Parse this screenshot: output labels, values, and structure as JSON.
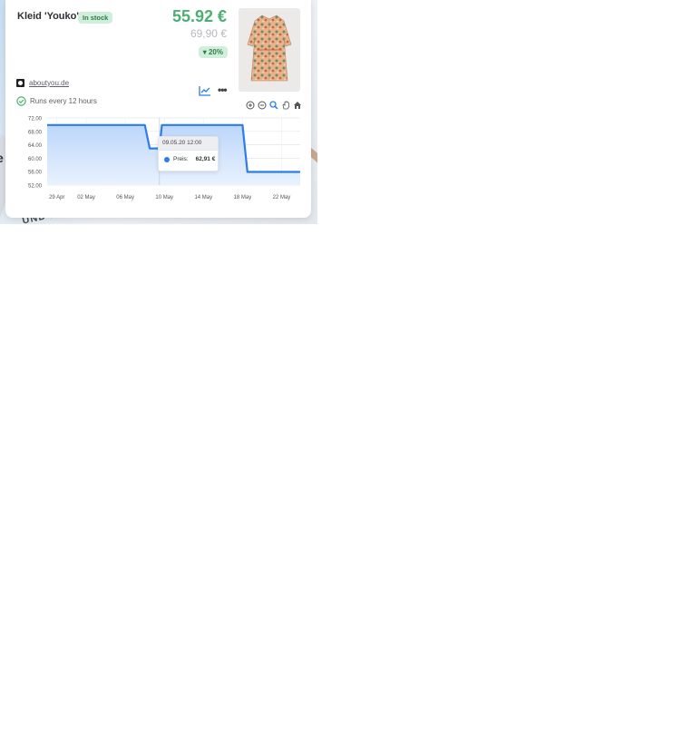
{
  "background": {
    "map_text": "UND RTS",
    "edge_glyph": "e"
  },
  "product": {
    "title": "Kleid 'Youko'",
    "stock_badge": "In stock",
    "price_current": "55.92 €",
    "price_original": "69,90 €",
    "discount": "20%",
    "site": "aboutyou.de",
    "schedule": "Runs every 12 hours"
  },
  "toolbar": {
    "chart_icon": "line-chart-icon",
    "more_icon": "more-horizontal-icon",
    "zoom_tools": [
      "zoom-in-icon",
      "zoom-out-icon",
      "magnifier-icon",
      "pan-hand-icon",
      "home-icon"
    ]
  },
  "colors": {
    "accent": "#2b7de9",
    "price_green": "#4caf72",
    "badge_bg": "#cfeedb"
  },
  "chart_data": {
    "type": "area",
    "title": "",
    "xlabel": "",
    "ylabel": "",
    "ylim": [
      52,
      72
    ],
    "xlim": [
      "2020-04-28",
      "2020-05-24"
    ],
    "y_ticks": [
      "72.00",
      "68.00",
      "64.00",
      "60.00",
      "56.00",
      "52.00"
    ],
    "x_ticks": [
      {
        "date": "2020-04-29",
        "label": "29 Apr"
      },
      {
        "date": "2020-05-02",
        "label": "02 May"
      },
      {
        "date": "2020-05-06",
        "label": "06 May"
      },
      {
        "date": "2020-05-10",
        "label": "10 May"
      },
      {
        "date": "2020-05-14",
        "label": "14 May"
      },
      {
        "date": "2020-05-18",
        "label": "18 May"
      },
      {
        "date": "2020-05-22",
        "label": "22 May"
      }
    ],
    "grid": true,
    "series": [
      {
        "name": "Preis",
        "points": [
          {
            "x": "2020-04-28",
            "y": 69.9
          },
          {
            "x": "2020-05-08",
            "y": 69.9
          },
          {
            "x": "2020-05-08T12:00",
            "y": 62.91
          },
          {
            "x": "2020-05-09T12:00",
            "y": 62.91
          },
          {
            "x": "2020-05-09T18:00",
            "y": 69.9
          },
          {
            "x": "2020-05-18T00:00",
            "y": 69.9
          },
          {
            "x": "2020-05-18T12:00",
            "y": 55.92
          },
          {
            "x": "2020-05-24",
            "y": 55.92
          }
        ]
      }
    ],
    "tooltip": {
      "date": "09.05.20 12:00",
      "series_label": "Preis:",
      "value": "62,91 €",
      "x": "2020-05-09T12:00",
      "y": 62.91
    }
  }
}
